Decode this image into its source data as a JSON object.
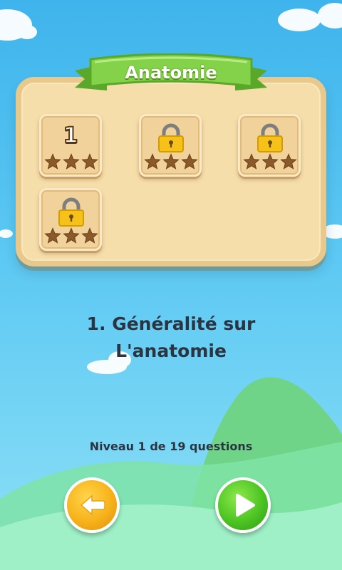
{
  "header": {
    "title": "Anatomie"
  },
  "levels": [
    {
      "number": "1",
      "locked": false,
      "stars_earned": 0,
      "stars_total": 3
    },
    {
      "number": "",
      "locked": true,
      "stars_earned": 0,
      "stars_total": 3
    },
    {
      "number": "",
      "locked": true,
      "stars_earned": 0,
      "stars_total": 3
    },
    {
      "number": "",
      "locked": true,
      "stars_earned": 0,
      "stars_total": 3
    }
  ],
  "selected_level": {
    "name_line1": "1. Généralité sur",
    "name_line2": "L'anatomie",
    "info": "Niveau 1 de 19 questions"
  },
  "buttons": {
    "back_icon": "arrow-left-icon",
    "next_icon": "play-icon"
  },
  "colors": {
    "sky": "#3fb4ec",
    "board": "#f6deaa",
    "ribbon": "#7fd046",
    "star": "#8a5a2b",
    "lock": "#f6c21a"
  }
}
